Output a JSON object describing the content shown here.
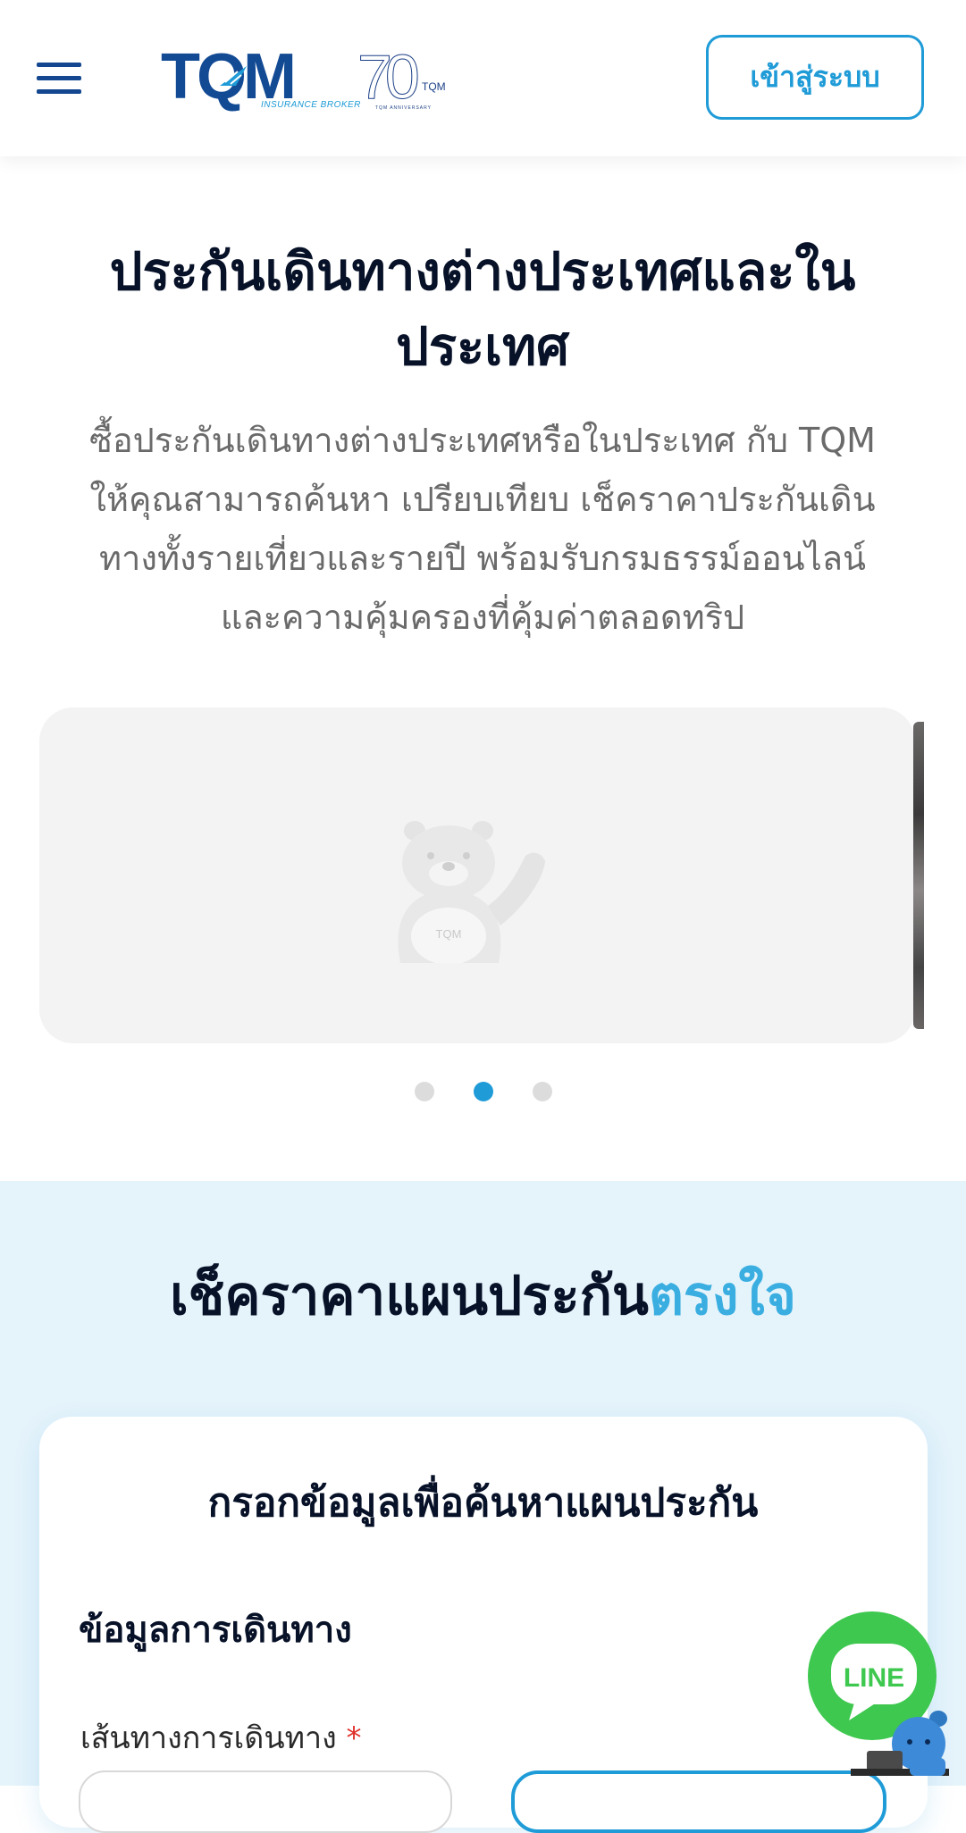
{
  "header": {
    "brand": "TQM",
    "brand_sub": "INSURANCE BROKER",
    "anniversary_number": "70",
    "anniversary_brand": "TQM",
    "anniversary_text": "TQM ANNIVERSARY",
    "login_label": "เข้าสู่ระบบ"
  },
  "hero": {
    "title_line1": "ประกันเดินทางต่างประเทศและใน",
    "title_line2": "ประเทศ",
    "desc_line1": "ซื้อประกันเดินทางต่างประเทศหรือในประเทศ กับ TQM",
    "desc_line2": "ให้คุณสามารถค้นหา เปรียบเทียบ เช็คราคาประกันเดิน",
    "desc_line3": "ทางทั้งรายเที่ยวและรายปี พร้อมรับกรมธรรม์ออนไลน์",
    "desc_line4": "และความคุ้มครองที่คุ้มค่าตลอดทริป"
  },
  "carousel": {
    "mascot_text": "TQM",
    "slide_count": 3,
    "active_index": 1
  },
  "check": {
    "title_main": "เช็คราคาแผนประกัน",
    "title_accent": "ตรงใจ",
    "accent_color": "#3aaee0"
  },
  "form": {
    "title": "กรอกข้อมูลเพื่อค้นหาแผนประกัน",
    "section_label": "ข้อมูลการเดินทาง",
    "route_label": "เส้นทางการเดินทาง",
    "required_mark": "*"
  },
  "line_chat": {
    "label": "LINE",
    "brand_color": "#3ec84f"
  },
  "colors": {
    "primary": "#1f9bd7",
    "brand_navy": "#124a94",
    "section_bg": "#e5f3fb"
  }
}
